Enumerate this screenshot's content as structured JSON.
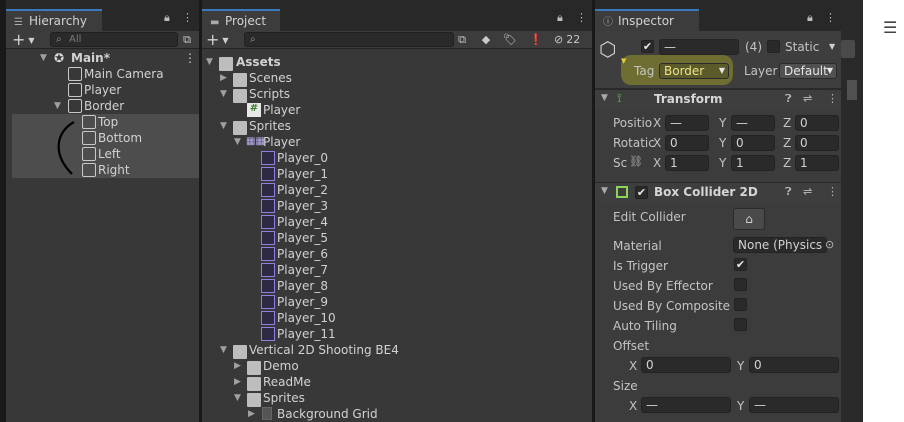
{
  "hierarchy": {
    "tab_label": "Hierarchy",
    "search_placeholder": "All",
    "add_label": "+",
    "rows": [
      {
        "label": "Main*"
      },
      {
        "label": "Main Camera"
      },
      {
        "label": "Player"
      },
      {
        "label": "Border"
      },
      {
        "label": "Top"
      },
      {
        "label": "Bottom"
      },
      {
        "label": "Left"
      },
      {
        "label": "Right"
      }
    ]
  },
  "project": {
    "tab_label": "Project",
    "add_label": "+",
    "hidden_count": "22",
    "tree": [
      {
        "label": "Assets",
        "kind": "folder-open"
      },
      {
        "label": "Scenes",
        "kind": "folder"
      },
      {
        "label": "Scripts",
        "kind": "folder-open"
      },
      {
        "label": "Player",
        "kind": "script"
      },
      {
        "label": "Sprites",
        "kind": "folder-open"
      },
      {
        "label": "Player",
        "kind": "sheet"
      },
      {
        "label": "Player_0",
        "kind": "sprite"
      },
      {
        "label": "Player_1",
        "kind": "sprite"
      },
      {
        "label": "Player_2",
        "kind": "sprite"
      },
      {
        "label": "Player_3",
        "kind": "sprite"
      },
      {
        "label": "Player_4",
        "kind": "sprite"
      },
      {
        "label": "Player_5",
        "kind": "sprite"
      },
      {
        "label": "Player_6",
        "kind": "sprite"
      },
      {
        "label": "Player_7",
        "kind": "sprite"
      },
      {
        "label": "Player_8",
        "kind": "sprite"
      },
      {
        "label": "Player_9",
        "kind": "sprite"
      },
      {
        "label": "Player_10",
        "kind": "sprite"
      },
      {
        "label": "Player_11",
        "kind": "sprite"
      },
      {
        "label": "Vertical 2D Shooting BE4",
        "kind": "folder-open"
      },
      {
        "label": "Demo",
        "kind": "folder"
      },
      {
        "label": "ReadMe",
        "kind": "folder"
      },
      {
        "label": "Sprites",
        "kind": "folder-open"
      },
      {
        "label": "Background Grid",
        "kind": "image"
      }
    ]
  },
  "inspector": {
    "tab_label": "Inspector",
    "object_name": "—",
    "multi_count": "(4)",
    "static_label": "Static",
    "tag_label": "Tag",
    "tag_value": "Border",
    "layer_label": "Layer",
    "layer_value": "Default",
    "transform": {
      "title": "Transform",
      "position_label": "Positio",
      "rotation_label": "Rotatic",
      "scale_label": "Sc",
      "position": {
        "x": "—",
        "y": "—",
        "z": "0"
      },
      "rotation": {
        "x": "0",
        "y": "0",
        "z": "0"
      },
      "scale": {
        "x": "1",
        "y": "1",
        "z": "1"
      },
      "axis_x": "X",
      "axis_y": "Y",
      "axis_z": "Z"
    },
    "box_collider": {
      "title": "Box Collider 2D",
      "edit_collider_label": "Edit Collider",
      "material_label": "Material",
      "material_value": "None (Physics",
      "is_trigger_label": "Is Trigger",
      "is_trigger": true,
      "used_by_effector_label": "Used By Effector",
      "used_by_composite_label": "Used By Composite",
      "auto_tiling_label": "Auto Tiling",
      "offset_label": "Offset",
      "offset": {
        "x": "0",
        "y": "0"
      },
      "size_label": "Size",
      "size": {
        "x": "—",
        "y": "—"
      }
    }
  },
  "colors": {
    "selection": "#4d4d4d",
    "tag_highlight": "#c8c81e",
    "accent": "#3a79bb"
  }
}
